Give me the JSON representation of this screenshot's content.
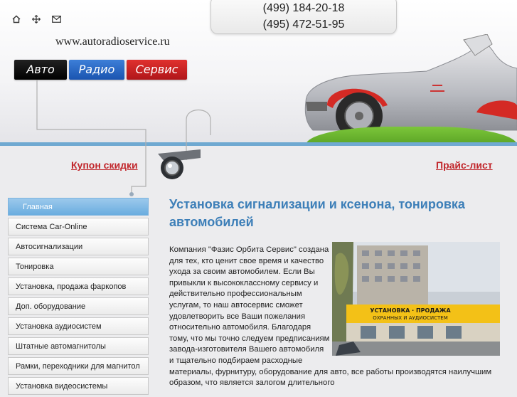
{
  "header": {
    "icons": [
      "home-icon",
      "sitemap-icon",
      "mail-icon"
    ],
    "phones": [
      "(499) 184-20-18",
      "(495) 472-51-95"
    ],
    "site_url": "www.autoradioservice.ru",
    "logo": {
      "word1": "Авто",
      "word2": "Радио",
      "word3": "Сервис"
    }
  },
  "links": {
    "coupon": "Купон скидки",
    "price_list": "Прайс-лист"
  },
  "nav": {
    "items": [
      {
        "label": "Главная",
        "active": true
      },
      {
        "label": "Система Car-Online"
      },
      {
        "label": "Автосигнализации"
      },
      {
        "label": "Тонировка"
      },
      {
        "label": "Установка, продажа фаркопов"
      },
      {
        "label": "Доп. оборудование"
      },
      {
        "label": "Установка аудиосистем"
      },
      {
        "label": "Штатные автомагнитолы"
      },
      {
        "label": "Рамки, переходники для магнитол"
      },
      {
        "label": "Установка видеосистемы"
      }
    ]
  },
  "main": {
    "title": "Установка сигнализации и ксенона, тонировка автомобилей",
    "paragraph": "Компания \"Фазис Орбита Сервис\" создана для тех, кто ценит свое время и качество ухода за своим автомобилем. Если Вы привыкли к высококлассному сервису и действительно профессиональным услугам, то наш автосервис сможет удовлетворить все Ваши пожелания относительно автомобиля. Благодаря тому, что мы точно следуем предписаниям завода-изготовителя Вашего автомобиля и тщательно подбираем расходные материалы, фурнитуру, оборудование для авто, все работы производятся наилучшим образом, что является залогом длительного",
    "photo": {
      "sign_line1": "УСТАНОВКА · ПРОДАЖА",
      "sign_line2": "ОХРАННЫХ И АУДИОСИСТЕМ"
    }
  },
  "colors": {
    "accent_blue": "#3d7fb8",
    "link_red": "#c1262b",
    "nav_active": "#7cb3de"
  }
}
